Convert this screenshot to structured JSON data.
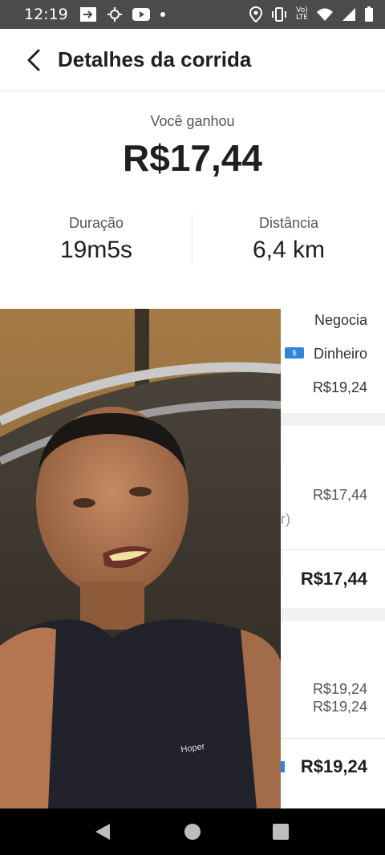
{
  "status_bar": {
    "time": "12:19",
    "lte": "Vo)\nLTE",
    "icons": [
      "cast-icon",
      "settings-icon",
      "youtube-icon",
      "dot-icon",
      "location-icon",
      "vibrate-icon",
      "lte-icon",
      "wifi-icon",
      "signal-icon",
      "battery-icon"
    ]
  },
  "header": {
    "title": "Detalhes da corrida"
  },
  "earnings": {
    "label": "Você ganhou",
    "amount": "R$17,44"
  },
  "stats": {
    "duration_label": "Duração",
    "duration_value": "19m5s",
    "distance_label": "Distância",
    "distance_value": "6,4 km"
  },
  "trip_info": {
    "negotiation": "Negocia",
    "payment_method": "Dinheiro",
    "cash_badge": "$",
    "price": "R$19,24"
  },
  "earnings_breakdown": {
    "line_value": "R$17,44",
    "fragment": "r)",
    "total": "R$17,44"
  },
  "fare_breakdown": {
    "line1": "R$19,24",
    "line2": "R$19,24",
    "total": "R$19,24"
  },
  "overlay": {
    "shirt_text": "Hoper"
  },
  "colors": {
    "status_bar": "#4b4b4b",
    "accent_blue": "#2f86d9",
    "nav_bar": "#000000"
  }
}
